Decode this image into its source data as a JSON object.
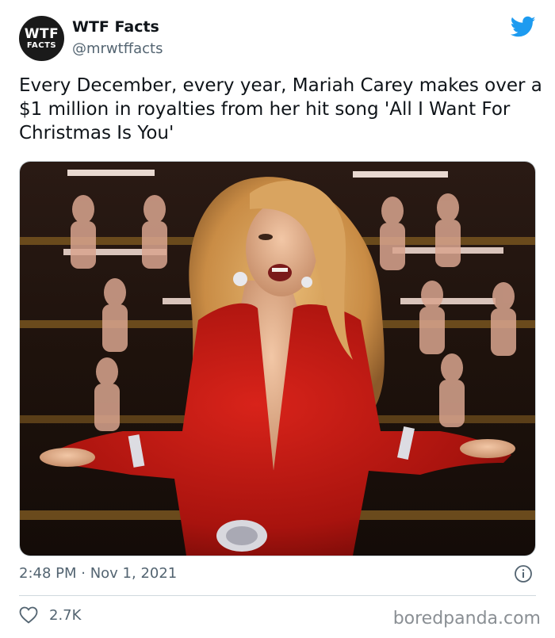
{
  "account": {
    "avatar_line1": "WTF",
    "avatar_line2": "FACTS",
    "display_name": "WTF Facts",
    "handle": "@mrwtffacts"
  },
  "tweet": {
    "text": "Every December, every year, Mariah Carey makes over a $1 million in royalties from her hit song 'All I Want For Christmas Is You'",
    "timestamp": "2:48 PM · Nov 1, 2021",
    "like_count": "2.7K"
  },
  "icons": {
    "brand": "twitter-bird-icon",
    "info": "info-icon",
    "like": "heart-icon"
  },
  "colors": {
    "twitter_blue": "#1d9bf0",
    "secondary_text": "#536471",
    "dress_red": "#b3140f"
  },
  "watermark": "boredpanda.com"
}
